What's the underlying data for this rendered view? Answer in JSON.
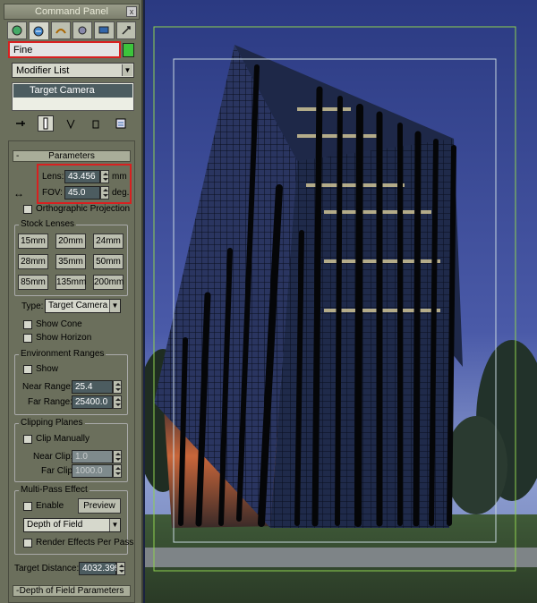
{
  "panel": {
    "title": "Command Panel",
    "close_glyph": "x",
    "tabs": [
      {
        "icon": "create-icon"
      },
      {
        "icon": "modify-icon"
      },
      {
        "icon": "hierarchy-icon"
      },
      {
        "icon": "motion-icon"
      },
      {
        "icon": "display-icon"
      },
      {
        "icon": "utilities-icon"
      }
    ],
    "object_name": "Fine",
    "object_color": "#3cc43c",
    "modifier_list": "Modifier List",
    "stack_items": [
      "Target Camera"
    ]
  },
  "parameters": {
    "title": "Parameters",
    "lens_label": "Lens:",
    "lens_value": "43.456",
    "lens_unit": "mm",
    "fov_label": "FOV:",
    "fov_value": "45.0",
    "fov_unit": "deg.",
    "ortho_label": "Orthographic Projection",
    "stock_title": "Stock Lenses",
    "stock_lenses": [
      "15mm",
      "20mm",
      "24mm",
      "28mm",
      "35mm",
      "50mm",
      "85mm",
      "135mm",
      "200mm"
    ],
    "type_label": "Type:",
    "type_value": "Target Camera",
    "show_cone": "Show Cone",
    "show_horizon": "Show Horizon",
    "env_title": "Environment Ranges",
    "env_show": "Show",
    "near_range_label": "Near Range:",
    "near_range_value": "25.4",
    "far_range_label": "Far Range:",
    "far_range_value": "25400.0",
    "clip_title": "Clipping Planes",
    "clip_manually": "Clip Manually",
    "near_clip_label": "Near Clip:",
    "near_clip_value": "1.0",
    "far_clip_label": "Far Clip:",
    "far_clip_value": "1000.0",
    "multipass_title": "Multi-Pass Effect",
    "enable_label": "Enable",
    "preview_label": "Preview",
    "effect_value": "Depth of Field",
    "render_per_pass": "Render Effects Per Pass",
    "target_distance_label": "Target Distance:",
    "target_distance_value": "4032.399"
  },
  "dof": {
    "title": "Depth of Field Parameters"
  },
  "colors": {
    "highlight": "#d82020",
    "camera_frame": "#8fd14f",
    "safe_frame": "#c8d8e0"
  }
}
